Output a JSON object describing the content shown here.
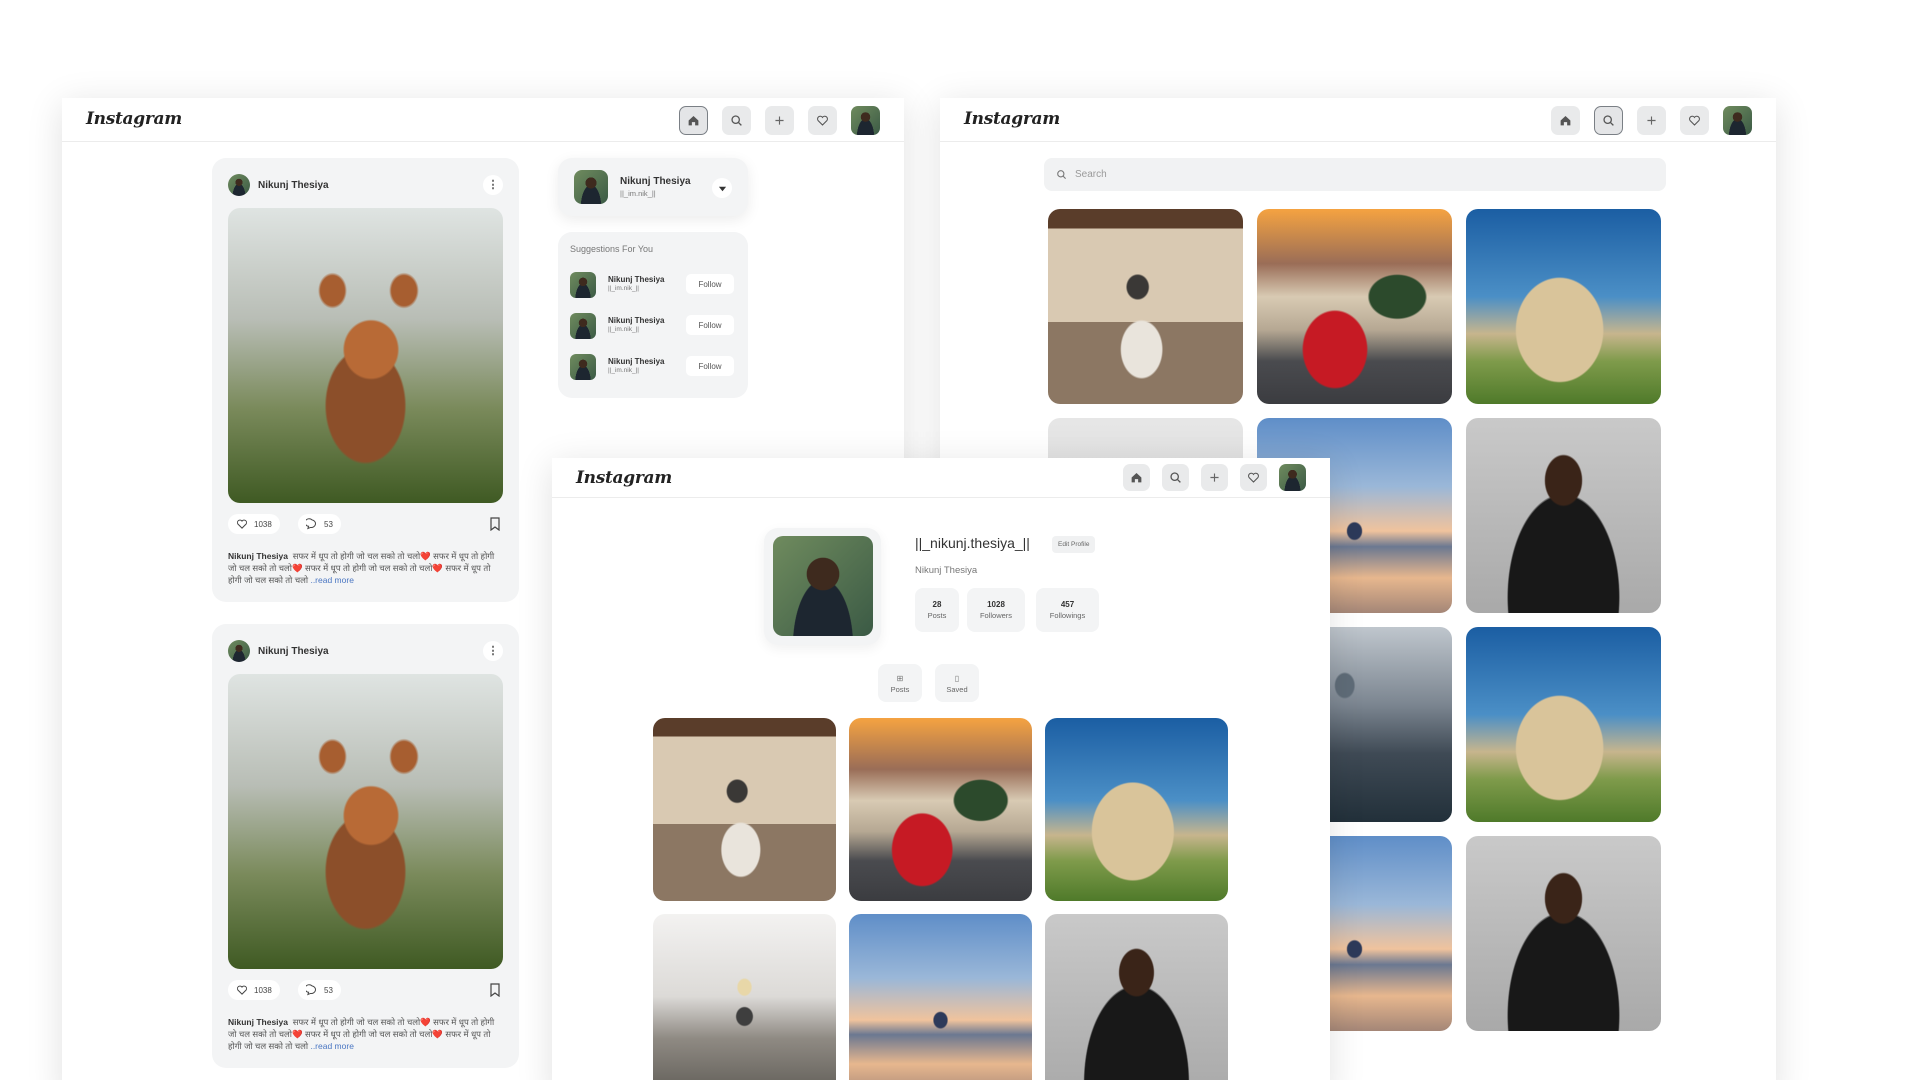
{
  "brand": "Instagram",
  "feed": {
    "posts": [
      {
        "username": "Nikunj Thesiya",
        "likes": "1038",
        "comments": "53",
        "caption_user": "Nikunj Thesiya",
        "caption": "सफर में धूप तो होगी जो चल सको तो चलो❤️ सफर में धूप तो होगी जो चल सको तो चलो❤️ सफर में धूप तो होगी जो चल सको तो चलो❤️ सफर में धूप तो होगी जो चल सको तो चलो",
        "read_more": "..read more"
      },
      {
        "username": "Nikunj Thesiya",
        "likes": "1038",
        "comments": "53",
        "caption_user": "Nikunj Thesiya",
        "caption": "सफर में धूप तो होगी जो चल सको तो चलो❤️ सफर में धूप तो होगी जो चल सको तो चलो❤️ सफर में धूप तो होगी जो चल सको तो चलो❤️ सफर में धूप तो होगी जो चल सको तो चलो",
        "read_more": "..read more"
      }
    ],
    "account": {
      "name": "Nikunj Thesiya",
      "handle": "||_im.nik_||"
    },
    "suggestions_title": "Suggestions For You",
    "suggestions": [
      {
        "name": "Nikunj Thesiya",
        "handle": "||_im.nik_||",
        "button": "Follow"
      },
      {
        "name": "Nikunj Thesiya",
        "handle": "||_im.nik_||",
        "button": "Follow"
      },
      {
        "name": "Nikunj Thesiya",
        "handle": "||_im.nik_||",
        "button": "Follow"
      }
    ]
  },
  "search": {
    "placeholder": "Search"
  },
  "profile": {
    "username": "||_nikunj.thesiya_||",
    "edit_label": "Edit Profile",
    "full_name": "Nikunj Thesiya",
    "stats": [
      {
        "value": "28",
        "label": "Posts"
      },
      {
        "value": "1028",
        "label": "Followers"
      },
      {
        "value": "457",
        "label": "Followings"
      }
    ],
    "tabs": [
      {
        "icon": "grid-icon",
        "label": "Posts"
      },
      {
        "icon": "bookmark-icon",
        "label": "Saved"
      }
    ]
  }
}
